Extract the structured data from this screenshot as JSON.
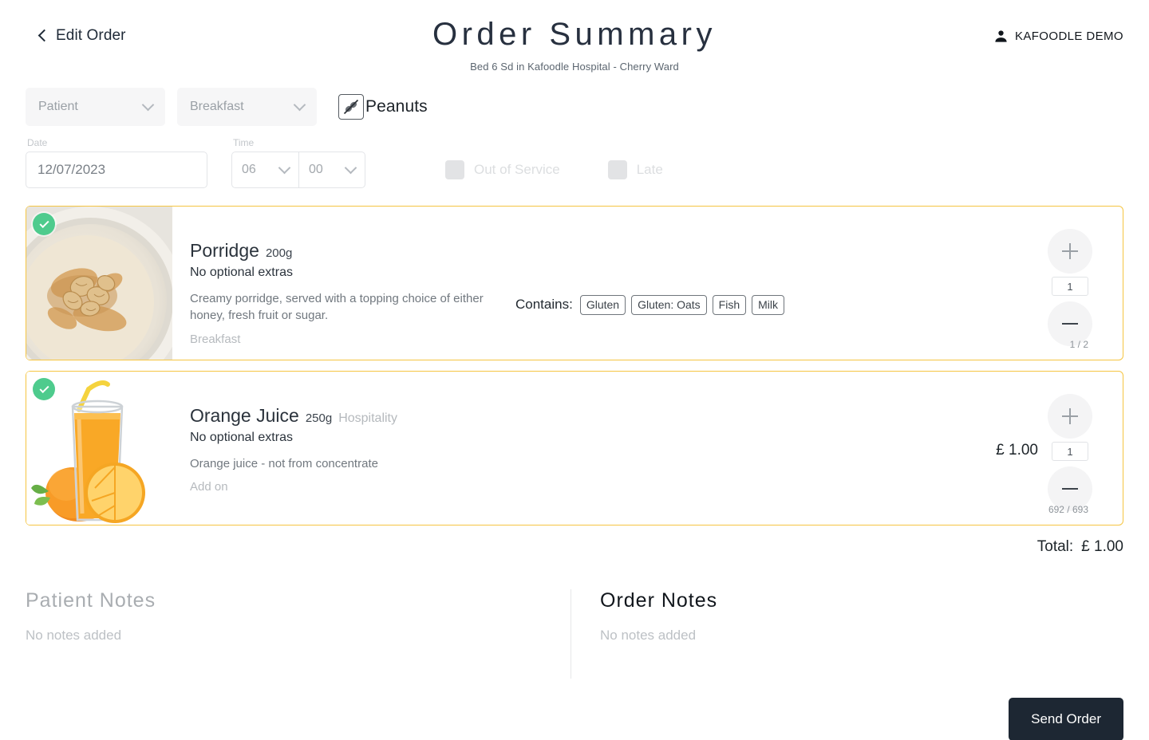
{
  "header": {
    "back_label": "Edit Order",
    "title": "Order Summary",
    "subtitle": "Bed 6 Sd in Kafoodle Hospital - Cherry Ward",
    "user_label": "KAFOODLE DEMO"
  },
  "filters": {
    "patient_select": {
      "value": "Patient"
    },
    "meal_select": {
      "value": "Breakfast"
    },
    "allergen": {
      "label": "Peanuts"
    },
    "date": {
      "label": "Date",
      "value": "12/07/2023"
    },
    "time": {
      "label": "Time",
      "hours": "06",
      "minutes": "00"
    },
    "checkboxes": [
      {
        "label": "Out of Service",
        "checked": false
      },
      {
        "label": "Late",
        "checked": false
      }
    ]
  },
  "items": [
    {
      "name": "Porridge",
      "weight": "200g",
      "tagword": "",
      "extras": "No optional extras",
      "description": "Creamy porridge, served with a topping choice of either honey, fresh fruit or sugar.",
      "category": "Breakfast",
      "contains_label": "Contains:",
      "allergens": [
        "Gluten",
        "Gluten: Oats",
        "Fish",
        "Milk"
      ],
      "price": "",
      "quantity": "1",
      "stock": "1 / 2",
      "selected": true
    },
    {
      "name": "Orange Juice",
      "weight": "250g",
      "tagword": "Hospitality",
      "extras": "No optional extras",
      "description": "Orange juice - not from concentrate",
      "category": "Add on",
      "contains_label": "",
      "allergens": [],
      "price": "£ 1.00",
      "quantity": "1",
      "stock": "692 / 693",
      "selected": true
    }
  ],
  "total": {
    "label": "Total:",
    "value": "£ 1.00"
  },
  "notes": {
    "patient": {
      "title": "Patient Notes",
      "empty": "No notes added"
    },
    "order": {
      "title": "Order Notes",
      "empty": "No notes added"
    }
  },
  "send_button": {
    "label": "Send Order"
  },
  "colors": {
    "card_border": "#f5c542",
    "check_badge": "#4ecb8d",
    "send_button_bg": "#1d2733",
    "accent_text": "#1f2a37"
  }
}
